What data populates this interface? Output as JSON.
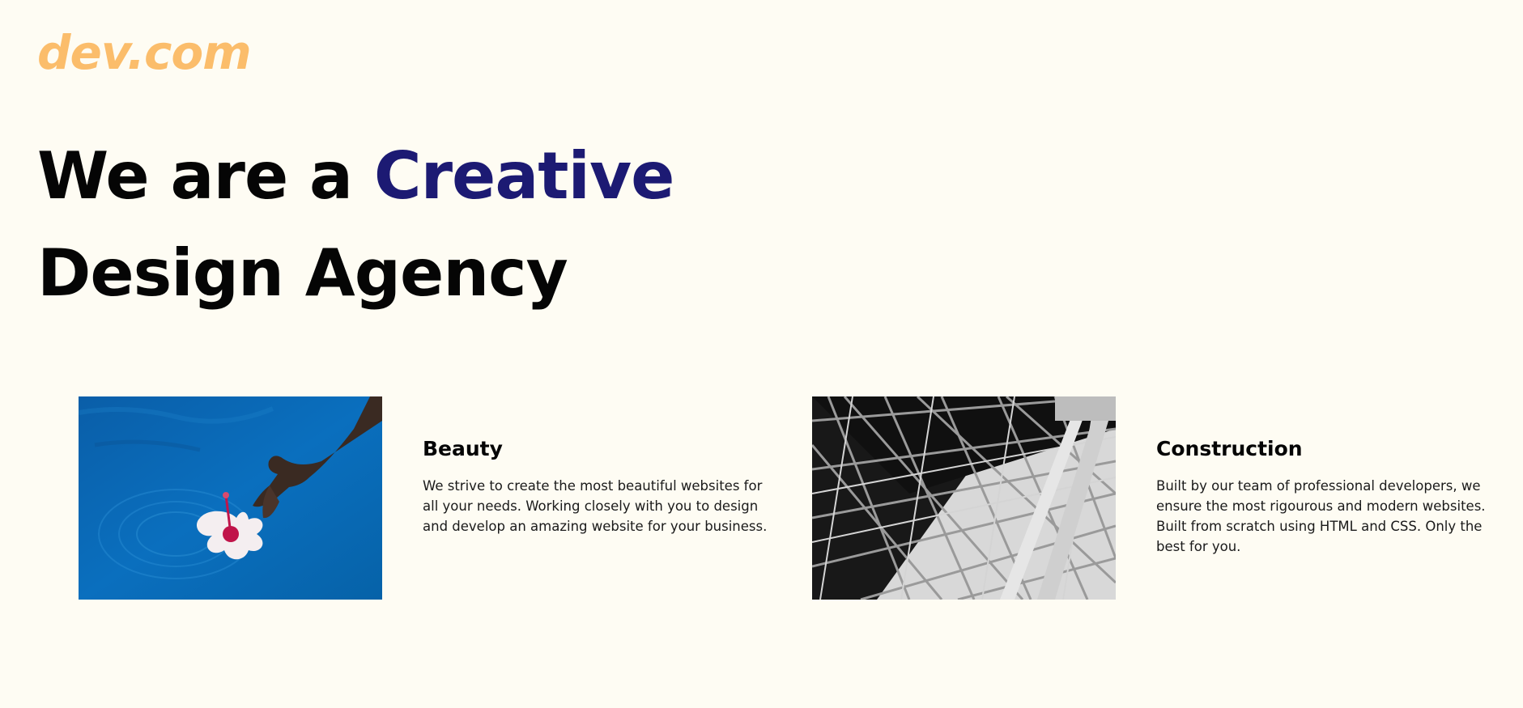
{
  "brand": {
    "logo_text": "dev.com"
  },
  "hero": {
    "line1_prefix": "We are a ",
    "line1_highlight": "Creative",
    "line2": "Design Agency"
  },
  "services": [
    {
      "title": "Beauty",
      "description": "We strive to create the most beautiful websites for all your needs. Working closely with you to design and develop an amazing website for your business.",
      "image_subject": "hand-placing-flower-in-water"
    },
    {
      "title": "Construction",
      "description": "Built by our team of professional developers, we ensure the most rigourous and modern websites. Built from scratch using HTML and CSS. Only the best for you.",
      "image_subject": "steel-structure-black-and-white"
    }
  ],
  "colors": {
    "background": "#fefcf3",
    "logo": "#fbbd6b",
    "highlight": "#1c1a73",
    "text": "#050505"
  }
}
